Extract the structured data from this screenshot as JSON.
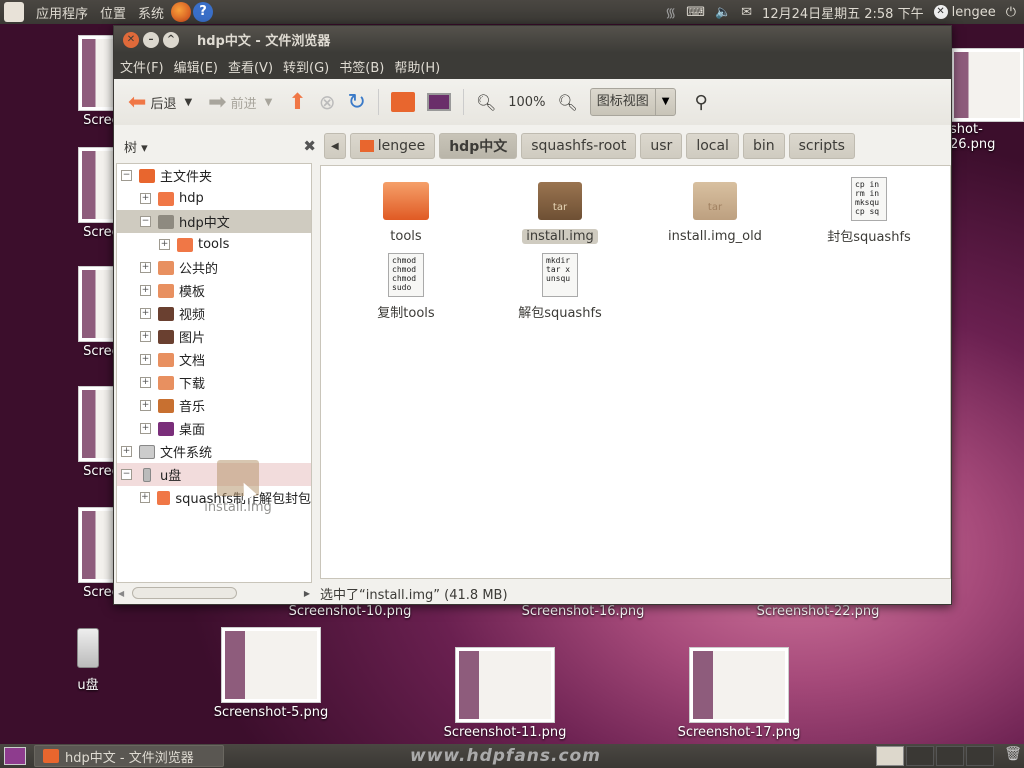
{
  "top_panel": {
    "applications": "应用程序",
    "places": "位置",
    "system": "系统",
    "datetime": "12月24日星期五  2:58 下午",
    "user": "lengee"
  },
  "desktop": {
    "icons": [
      {
        "label": "Screensh",
        "left": "58",
        "top": "35"
      },
      {
        "label": "Screensh",
        "left": "58",
        "top": "147"
      },
      {
        "label": "Screensh",
        "left": "58",
        "top": "266"
      },
      {
        "label": "Screensh",
        "left": "58",
        "top": "386"
      },
      {
        "label": "Screensh",
        "left": "58",
        "top": "507"
      }
    ],
    "labels": {
      "s26": "shot-26.png",
      "s10": "Screenshot-10.png",
      "s16": "Screenshot-16.png",
      "s22": "Screenshot-22.png",
      "s5": "Screenshot-5.png",
      "s11": "Screenshot-11.png",
      "s17": "Screenshot-17.png",
      "usb": "u盘"
    }
  },
  "window": {
    "title": "hdp中文 - 文件浏览器"
  },
  "menu": [
    "文件(F)",
    "编辑(E)",
    "查看(V)",
    "转到(G)",
    "书签(B)",
    "帮助(H)"
  ],
  "toolbar": {
    "back": "后退",
    "forward": "前进",
    "zoom": "100%",
    "view_mode": "图标视图"
  },
  "breadcrumbs": [
    "lengee",
    "hdp中文",
    "squashfs-root",
    "usr",
    "local",
    "bin",
    "scripts"
  ],
  "sidebar": {
    "mode": "树",
    "tree": [
      "主文件夹",
      "hdp",
      "hdp中文",
      "tools",
      "公共的",
      "模板",
      "视频",
      "图片",
      "文档",
      "下载",
      "音乐",
      "桌面",
      "文件系统",
      "u盘",
      "squashfs制作解包封包"
    ]
  },
  "files": [
    {
      "name": "tools",
      "type": "folder"
    },
    {
      "name": "install.img",
      "type": "tar",
      "selected": true
    },
    {
      "name": "install.img_old",
      "type": "tar"
    },
    {
      "name": "封包squashfs",
      "type": "script",
      "preview": "cp in\nrm in\nmksqu\ncp sq"
    },
    {
      "name": "复制tools",
      "type": "script",
      "preview": "chmod\nchmod\nchmod\nsudo"
    },
    {
      "name": "解包squashfs",
      "type": "script",
      "preview": "mkdir\ntar x\nunsqu"
    }
  ],
  "status": "选中了“install.img” (41.8 MB)",
  "drag_ghost": "install.img",
  "taskbar": {
    "item": "hdp中文 - 文件浏览器",
    "watermark": "www.hdpfans.com"
  },
  "colors": {
    "accent": "#f07746",
    "selection": "#cfcbc0",
    "panel": "#3c3b37"
  }
}
